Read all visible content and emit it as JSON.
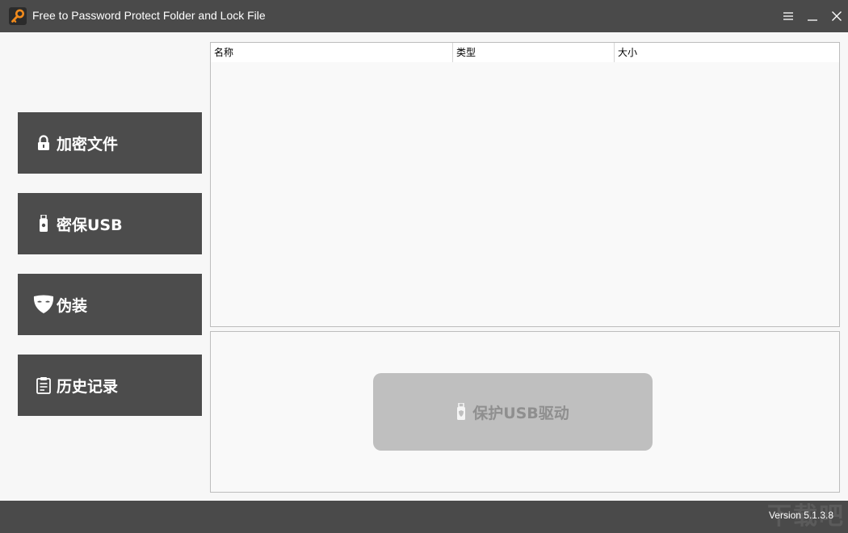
{
  "window": {
    "title": "Free to Password Protect Folder and Lock File",
    "icons": {
      "logo": "key-icon",
      "menu": "menu-icon",
      "minimize": "minimize-icon",
      "close": "close-icon"
    }
  },
  "sidebar": {
    "items": [
      {
        "label": "加密文件",
        "icon": "lock-icon"
      },
      {
        "label": "密保USB",
        "icon": "usb-icon"
      },
      {
        "label": "伪装",
        "icon": "mask-icon"
      },
      {
        "label": "历史记录",
        "icon": "history-icon"
      }
    ]
  },
  "table": {
    "columns": [
      "名称",
      "类型",
      "大小"
    ],
    "rows": []
  },
  "action": {
    "label": "保护USB驱动",
    "icon": "usb-shield-icon"
  },
  "footer": {
    "version": "Version 5.1.3.8",
    "watermark": "下载吧"
  },
  "colors": {
    "titlebar": "#4a4a4a",
    "sidebar_button": "#4c4c4c",
    "action_button": "#bfbfbf",
    "accent": "#f08a1c"
  }
}
